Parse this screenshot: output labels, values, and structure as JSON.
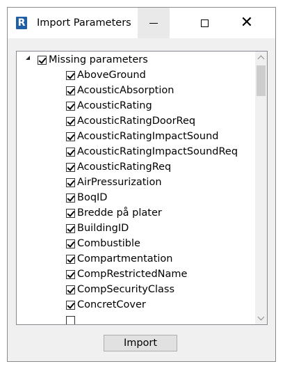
{
  "window": {
    "title": "Import Parameters",
    "app_icon_letter": "R"
  },
  "tree": {
    "root": {
      "label": "Missing parameters",
      "checked": true,
      "expanded": true
    },
    "items": [
      {
        "label": "AboveGround",
        "checked": true
      },
      {
        "label": "AcousticAbsorption",
        "checked": true
      },
      {
        "label": "AcousticRating",
        "checked": true
      },
      {
        "label": "AcousticRatingDoorReq",
        "checked": true
      },
      {
        "label": "AcousticRatingImpactSound",
        "checked": true
      },
      {
        "label": "AcousticRatingImpactSoundReq",
        "checked": true
      },
      {
        "label": "AcousticRatingReq",
        "checked": true
      },
      {
        "label": "AirPressurization",
        "checked": true
      },
      {
        "label": "BoqID",
        "checked": true
      },
      {
        "label": "Bredde på plater",
        "checked": true
      },
      {
        "label": "BuildingID",
        "checked": true
      },
      {
        "label": "Combustible",
        "checked": true
      },
      {
        "label": "Compartmentation",
        "checked": true
      },
      {
        "label": "CompRestrictedName",
        "checked": true
      },
      {
        "label": "CompSecurityClass",
        "checked": true
      },
      {
        "label": "ConcretCover",
        "checked": true
      }
    ]
  },
  "buttons": {
    "import_label": "Import"
  }
}
